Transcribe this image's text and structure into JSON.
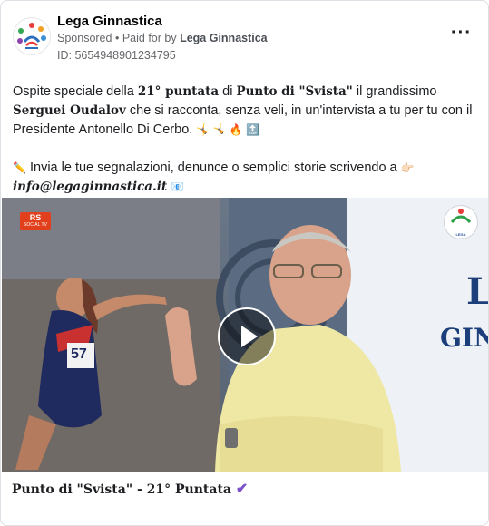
{
  "post": {
    "page_name": "Lega Ginnastica",
    "sponsored_label": "Sponsored",
    "separator": "•",
    "paid_for_prefix": "Paid for by",
    "paid_for_by": "Lega Ginnastica",
    "ad_id": "ID: 5654948901234795",
    "more_icon": "more-options-icon"
  },
  "text": {
    "p1_a": "Ospite speciale della ",
    "p1_b": "21° puntata",
    "p1_c": " di ",
    "p1_d": "Punto di \"Svista\"",
    "p1_e": " il grandissimo ",
    "p1_f": "Serguei Oudalov",
    "p1_g": " che si racconta, senza veli, in un'intervista a tu per tu con il Presidente Antonello Di Cerbo.",
    "p1_emojis": "🤸 🤸 🔥 🔝",
    "p2_pencil": "✏️",
    "p2_a": " Invia le tue segnalazioni, denunce o semplici storie scrivendo a ",
    "p2_hand": "👉🏻",
    "p2_email": "info@legaginnastica.it",
    "p2_mail": "📧"
  },
  "video": {
    "badge_top": "RS",
    "badge_bottom": "SOCIAL TV",
    "logo_text": "LEGA GINNASTICA",
    "banner_text_1": "L",
    "banner_text_2": "GIN",
    "athlete_number": "57",
    "play_icon": "play-icon"
  },
  "caption": {
    "title": "Punto di \"Svista\" - 21° Puntata",
    "check": "✔"
  },
  "colors": {
    "text": "#1c1e21",
    "secondary": "#65676b",
    "accent_check": "#7b52c9",
    "shirt": "#efe7a4"
  }
}
